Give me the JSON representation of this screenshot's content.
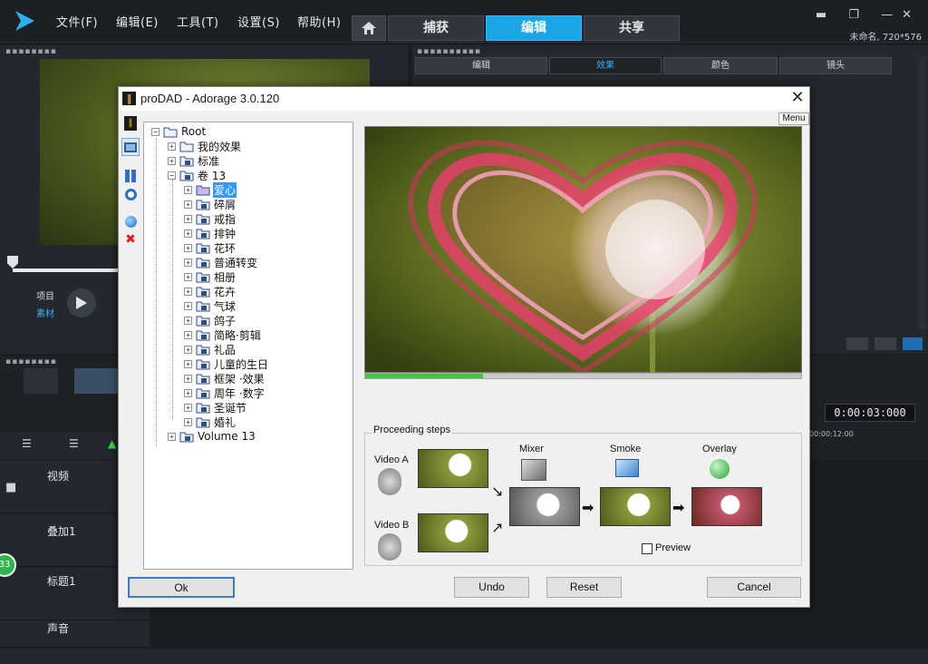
{
  "app": {
    "menus": [
      "文件(F)",
      "编辑(E)",
      "工具(T)",
      "设置(S)",
      "帮助(H)"
    ],
    "main_tabs": [
      "捕获",
      "编辑",
      "共享"
    ],
    "active_main_tab": "编辑",
    "project_info": "未命名, 720*576",
    "sub_tabs": [
      "编辑",
      "效果",
      "颜色",
      "镜头"
    ],
    "active_sub_tab": "效果",
    "timecode": "0:00:03:000",
    "ruler_time": "00:00:12:00",
    "project_label": "项目",
    "clip_label": "素材",
    "tracks": [
      "视频",
      "叠加1",
      "标题1",
      "声音"
    ],
    "badge": "33",
    "accent": "#19a5e6"
  },
  "dialog": {
    "title": "proDAD - Adorage 3.0.120",
    "menu_button": "Menu",
    "tree": {
      "root": "Root",
      "level1": [
        "我的效果",
        "标准",
        "卷 13"
      ],
      "vol13_children": [
        "爱心",
        "碎屑",
        "戒指",
        "排钟",
        "花环",
        "普通转变",
        "相册",
        "花卉",
        "气球",
        "鸽子",
        "简略·剪辑",
        "礼品",
        "儿童的生日",
        "框架 ·效果",
        "周年 ·数字",
        "圣诞节",
        "婚礼"
      ],
      "selected": "爱心",
      "last": "Volume 13"
    },
    "progress_fraction": 0.27,
    "proceeding": {
      "legend": "Proceeding steps",
      "video_a": "Video A",
      "video_b": "Video B",
      "mixer": "Mixer",
      "smoke": "Smoke",
      "overlay": "Overlay",
      "preview_label": "Preview",
      "preview_checked": false
    },
    "buttons": {
      "ok": "Ok",
      "undo": "Undo",
      "reset": "Reset",
      "cancel": "Cancel"
    }
  }
}
